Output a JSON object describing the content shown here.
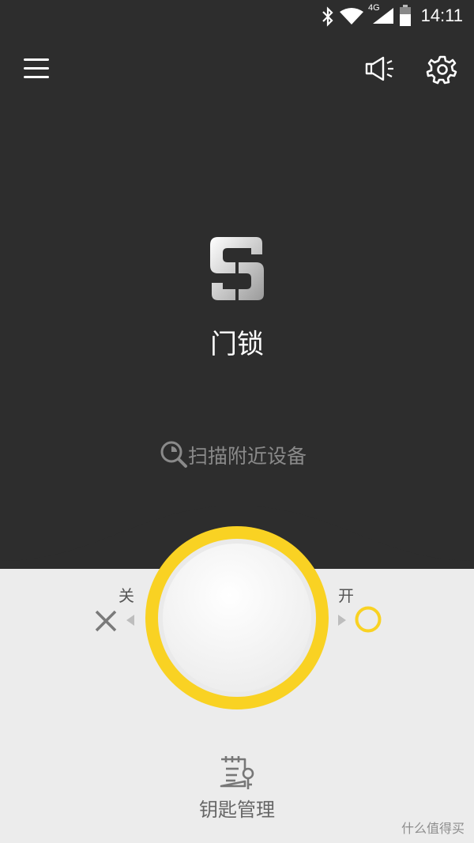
{
  "status_bar": {
    "time": "14:11",
    "network": "4G",
    "icons": [
      "bluetooth-icon",
      "wifi-icon",
      "cell-signal-icon",
      "battery-icon"
    ]
  },
  "toolbar": {
    "menu_icon": "hamburger-menu-icon",
    "alert_icon": "megaphone-icon",
    "settings_icon": "gear-icon"
  },
  "device": {
    "logo": "brand-s-logo",
    "name": "门锁"
  },
  "scan": {
    "label": "扫描附近设备",
    "icon": "search-scan-icon"
  },
  "lock_control": {
    "close_label": "关",
    "open_label": "开",
    "accent_color": "#f9d223",
    "close_icon": "close-x-icon",
    "open_icon": "open-circle-icon"
  },
  "bottom": {
    "keys_label": "钥匙管理",
    "keys_icon": "key-list-icon"
  },
  "watermark": {
    "text": "什么值得买"
  }
}
